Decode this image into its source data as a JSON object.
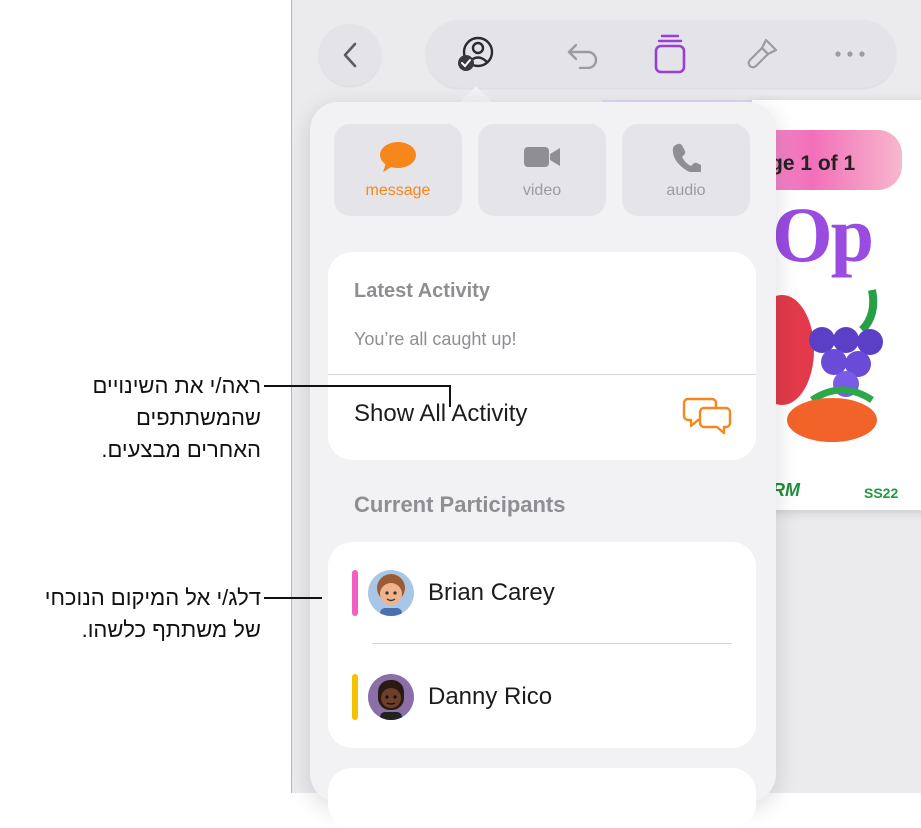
{
  "toolbar": {
    "back": "chevron-left-icon",
    "collaborate": "collaboration-icon",
    "undo": "undo-icon",
    "format": "document-stack-icon",
    "paint": "paintbrush-icon",
    "more": "more-icon"
  },
  "document": {
    "page_label": "ge 1 of 1",
    "big_text": "Op",
    "footer_left": "RM",
    "footer_right": "SS22"
  },
  "popover": {
    "buttons": [
      {
        "label": "message",
        "icon": "message-bubble-icon",
        "color": "#f7861b"
      },
      {
        "label": "video",
        "icon": "video-camera-icon"
      },
      {
        "label": "audio",
        "icon": "phone-icon"
      }
    ],
    "latest_activity": {
      "title": "Latest Activity",
      "status": "You’re all caught up!",
      "show_all": "Show All Activity",
      "show_all_icon": "chat-bubbles-icon"
    },
    "participants_title": "Current Participants",
    "participants": [
      {
        "name": "Brian Carey",
        "color": "#f25fc0"
      },
      {
        "name": "Danny Rico",
        "color": "#f3c200"
      }
    ]
  },
  "callouts": {
    "activity_lines": [
      "ראה/י את השינויים",
      "שהמשתתפים",
      "האחרים מבצעים."
    ],
    "participant_lines": [
      "דלג/י אל המיקום הנוכחי",
      "של משתתף כלשהו."
    ]
  }
}
